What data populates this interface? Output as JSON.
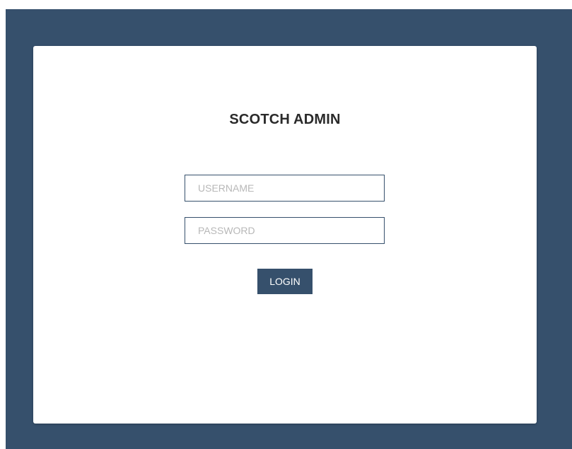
{
  "login": {
    "title": "SCOTCH ADMIN",
    "username_placeholder": "USERNAME",
    "password_placeholder": "PASSWORD",
    "submit_label": "LOGIN"
  },
  "colors": {
    "background": "#36506c",
    "card": "#ffffff",
    "accent": "#36506c",
    "title_text": "#2a2a2a",
    "placeholder_text": "#b8b8b8"
  }
}
